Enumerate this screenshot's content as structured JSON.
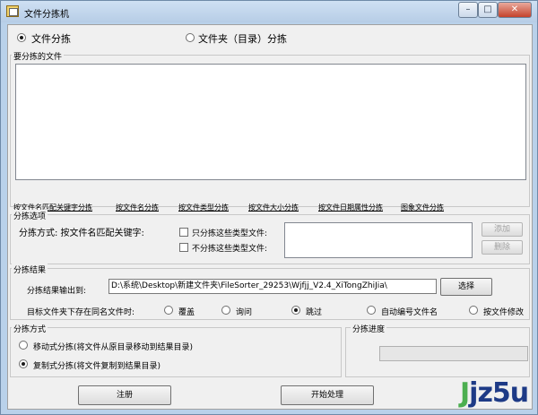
{
  "window": {
    "title": "文件分拣机"
  },
  "mode": {
    "file_label": "文件分拣",
    "folder_label": "文件夹（目录）分拣",
    "selected": "file"
  },
  "files_group": {
    "label": "要分拣的文件"
  },
  "tabs": [
    {
      "label": "按文件名匹配关键字分拣"
    },
    {
      "label": "按文件名分拣"
    },
    {
      "label": "按文件类型分拣"
    },
    {
      "label": "按文件大小分拣"
    },
    {
      "label": "按文件日期属性分拣"
    },
    {
      "label": "图象文件分拣"
    }
  ],
  "options": {
    "label": "分拣选项",
    "method_text": "分拣方式:  按文件名匹配关键字:",
    "only_types": "只分拣这些类型文件:",
    "exclude_types": "不分拣这些类型文件:",
    "add_button": "添加",
    "delete_button": "删除"
  },
  "result": {
    "label": "分拣结果",
    "output_label": "分拣结果输出到:",
    "output_path": "D:\\系统\\Desktop\\新建文件夹\\FileSorter_29253\\Wjfjj_V2.4_XiTongZhiJia\\",
    "browse_button": "选择",
    "conflict_label": "目标文件夹下存在同名文件时:",
    "conflict_options": [
      "覆盖",
      "询问",
      "跳过",
      "自动编号文件名",
      "按文件修改"
    ],
    "conflict_selected": 2
  },
  "sort_mode": {
    "label": "分拣方式",
    "move_label": "移动式分拣(将文件从原目录移动到结果目录)",
    "copy_label": "复制式分拣(将文件复制到结果目录)",
    "selected": "copy"
  },
  "progress": {
    "label": "分拣进度",
    "fraction": 0
  },
  "buttons": {
    "register": "注册",
    "start": "开始处理"
  },
  "watermark": {
    "text": "jz5u"
  }
}
